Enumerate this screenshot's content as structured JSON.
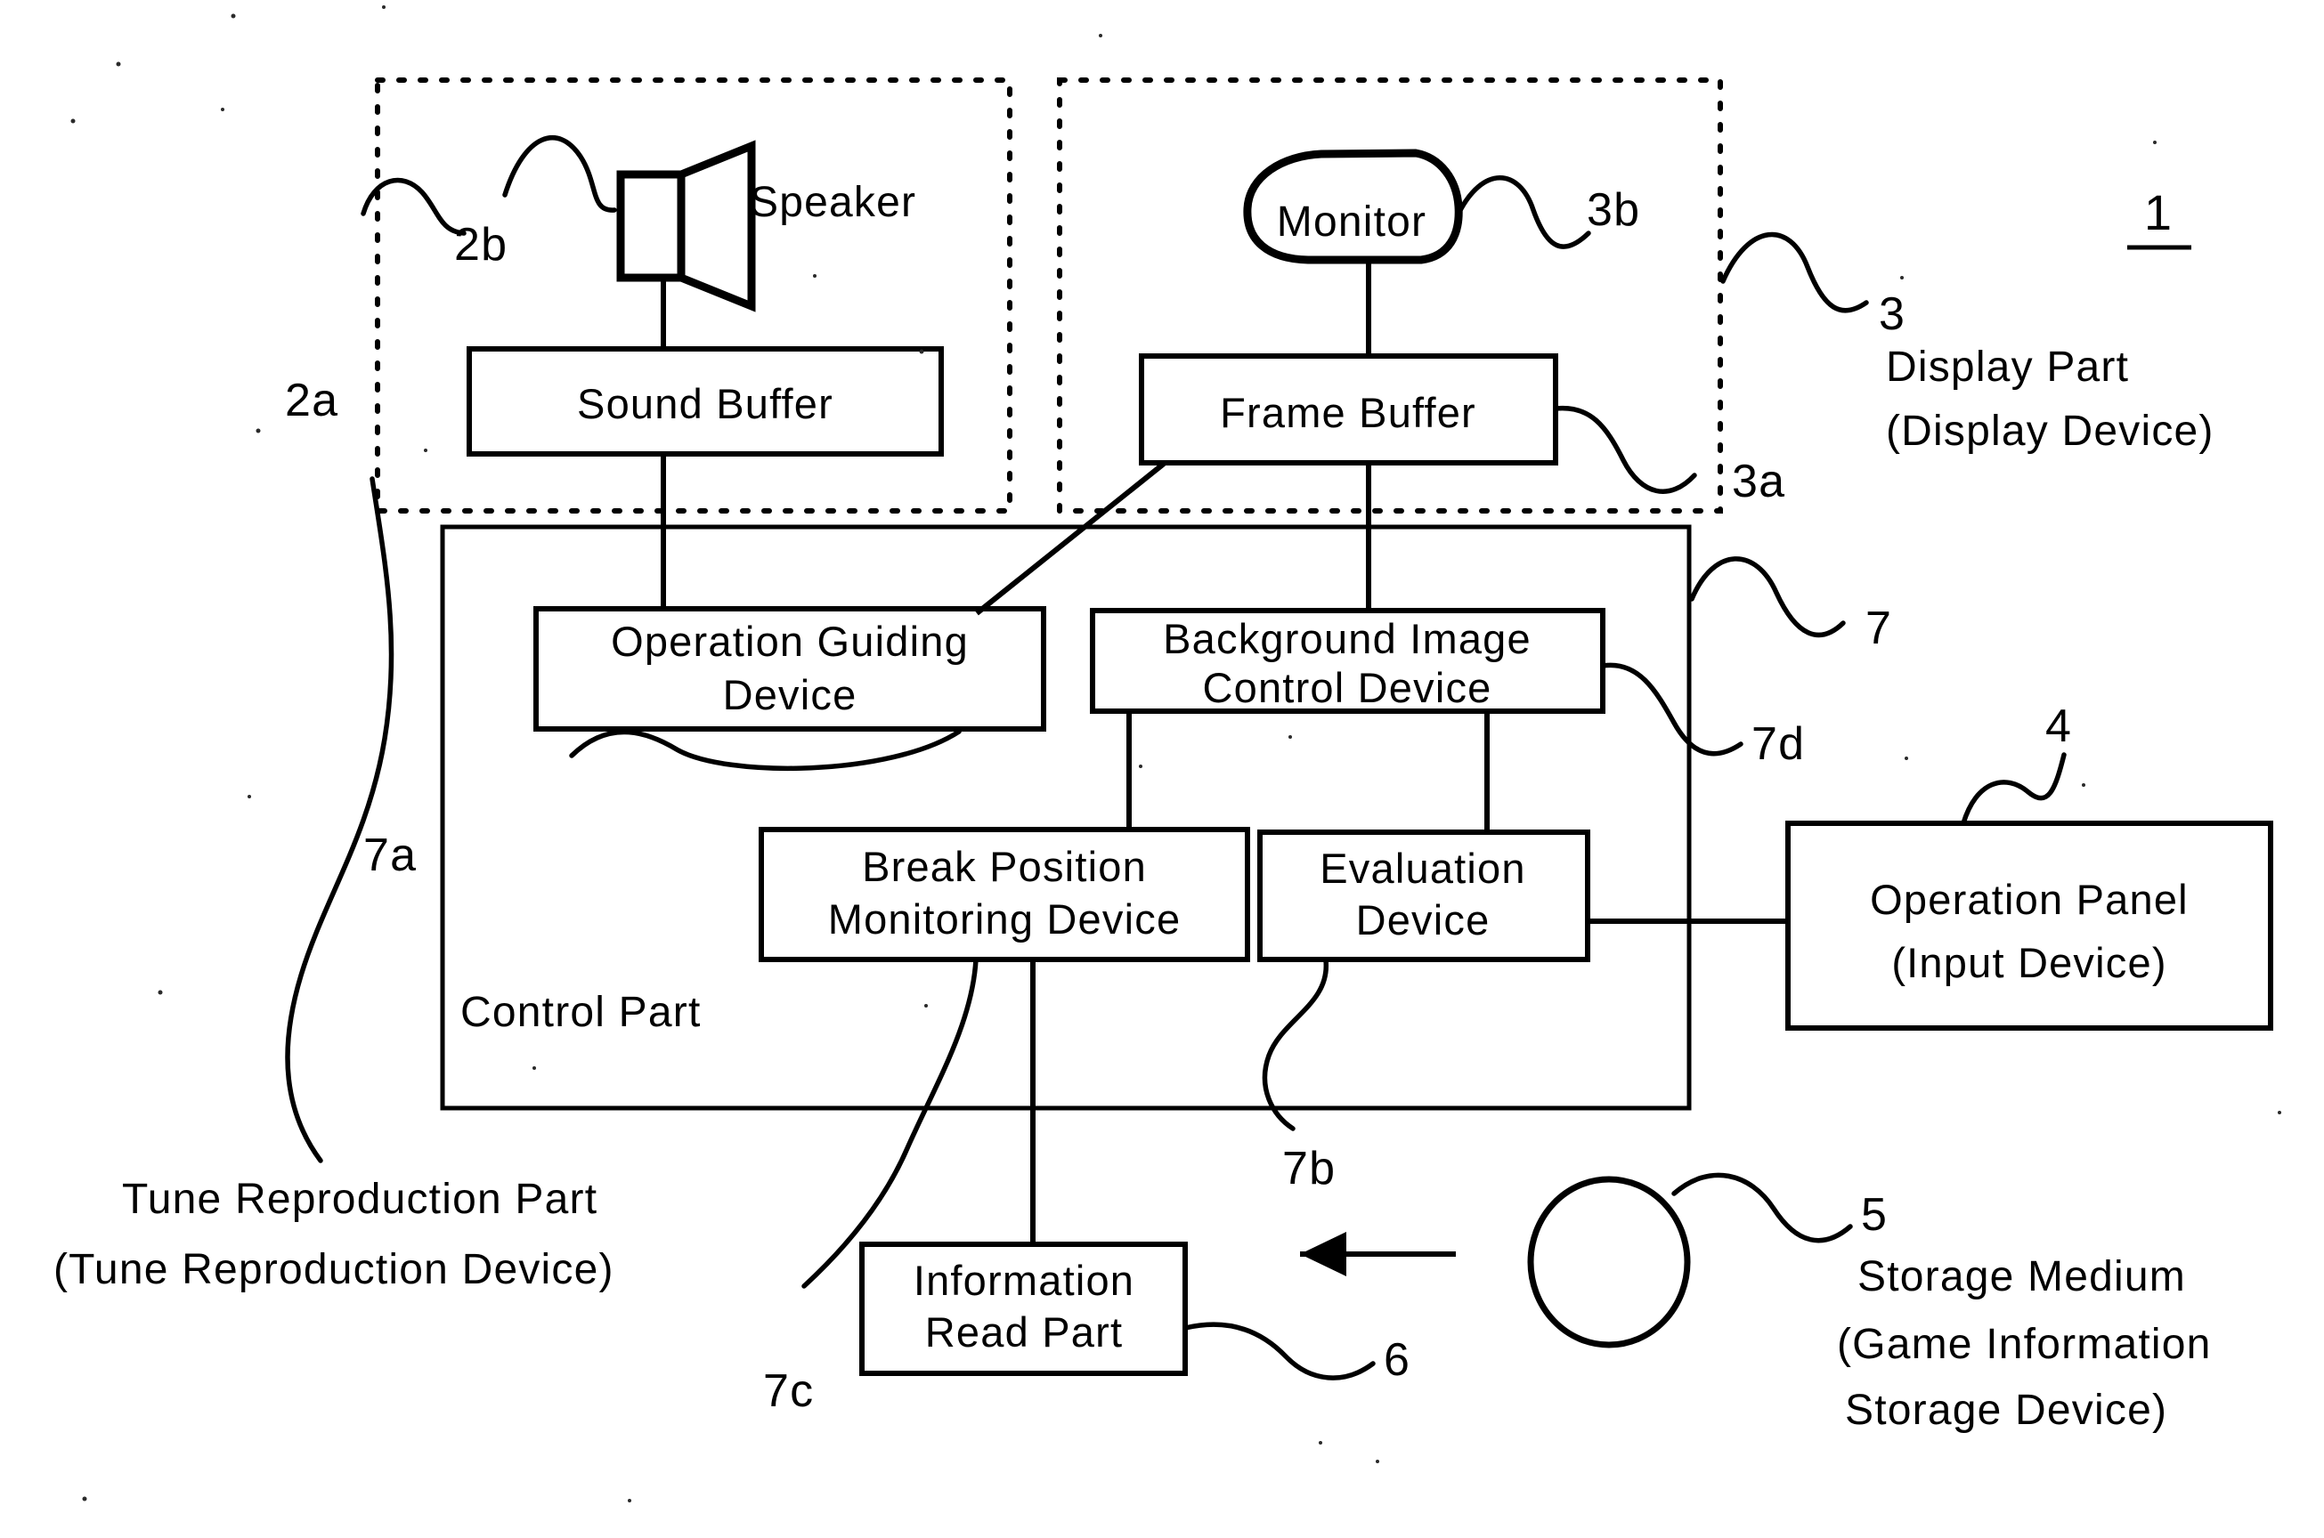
{
  "figure": {
    "number": "1",
    "title_underlined": true
  },
  "dotted_groups": [
    {
      "name": "tune-reproduction-group",
      "ref": "2a"
    },
    {
      "name": "display-part-group",
      "ref": "3a"
    }
  ],
  "nodes": {
    "speaker": {
      "label": "Speaker",
      "ref": "2b",
      "icon": "speaker-icon"
    },
    "monitor": {
      "label": "Monitor",
      "ref": "3b",
      "icon": "monitor-shape-icon"
    },
    "sound_buffer": {
      "label": "Sound  Buffer"
    },
    "frame_buffer": {
      "label": "Frame  Buffer"
    },
    "control_part": {
      "label": "Control  Part",
      "ref": "7"
    },
    "operation_guiding_device": {
      "label_line1": "Operation  Guiding",
      "label_line2": "Device",
      "ref": "7a"
    },
    "background_image_control_device": {
      "label_line1": "Background  Image",
      "label_line2": "Control  Device",
      "ref": "7d"
    },
    "break_position_monitoring_device": {
      "label_line1": "Break  Position",
      "label_line2": "Monitoring  Device"
    },
    "evaluation_device": {
      "label_line1": "Evaluation",
      "label_line2": "Device",
      "ref": "7b"
    },
    "information_read_part": {
      "label_line1": "Information",
      "label_line2": "Read  Part",
      "ref": "6",
      "ref2": "7c"
    },
    "operation_panel": {
      "label_line1": "Operation  Panel",
      "label_line2": "(Input  Device)",
      "ref": "4"
    },
    "storage_medium": {
      "ref": "5",
      "icon": "disc-icon"
    }
  },
  "captions": {
    "display_part": {
      "ref": "3",
      "line1": "Display  Part",
      "line2": "(Display  Device)"
    },
    "tune_reproduction_part": {
      "line1": "Tune  Reproduction  Part",
      "line2": "(Tune  Reproduction  Device)"
    },
    "storage_medium": {
      "line1": "Storage  Medium",
      "line2": "(Game  Information",
      "line3": "Storage  Device)"
    }
  },
  "ref_labels": {
    "two_a": "2a",
    "two_b": "2b",
    "three": "3",
    "three_a": "3a",
    "three_b": "3b",
    "four": "4",
    "five": "5",
    "six": "6",
    "seven": "7",
    "seven_a": "7a",
    "seven_b": "7b",
    "seven_c": "7c",
    "seven_d": "7d"
  },
  "arrow": {
    "name": "load-direction-arrow",
    "direction": "left"
  },
  "colors": {
    "ink": "#000000",
    "paper": "#ffffff"
  }
}
